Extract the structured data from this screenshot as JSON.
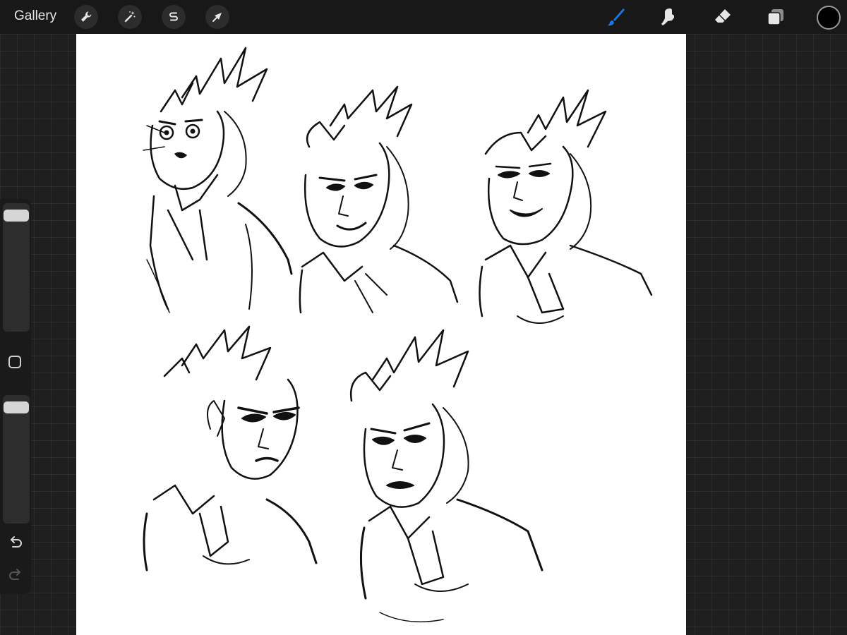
{
  "toolbar": {
    "gallery_label": "Gallery",
    "left_tools": [
      "wrench-icon",
      "magic-wand-icon",
      "selection-s-icon",
      "transform-arrow-icon"
    ],
    "right_tools": [
      "brush-icon",
      "smudge-icon",
      "eraser-icon",
      "layers-icon"
    ],
    "active_tool": "brush-icon",
    "active_color": "#1a77e6",
    "current_color": "#000000"
  },
  "sidebar": {
    "brush_size_level": 0.97,
    "opacity_level": 0.97,
    "controls": [
      "brush-size-slider",
      "modify-button",
      "opacity-slider",
      "undo-icon",
      "redo-icon"
    ]
  },
  "canvas": {
    "background": "#ffffff",
    "content": "character-sketches"
  }
}
